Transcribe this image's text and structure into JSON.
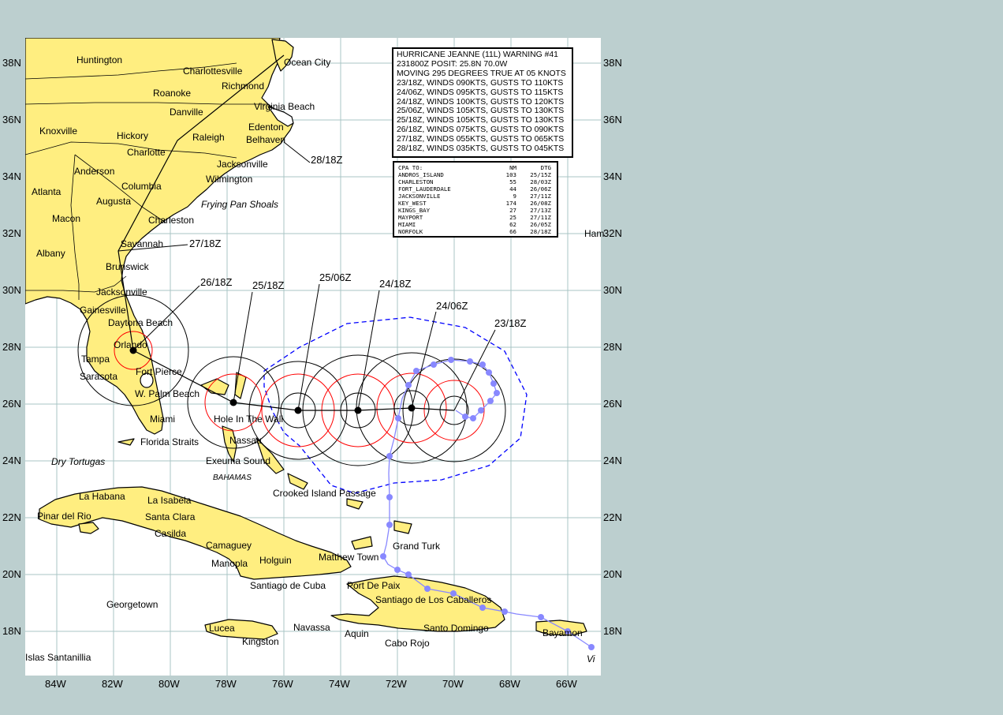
{
  "warning": {
    "lines": [
      "HURRICANE JEANNE (11L) WARNING #41",
      "231800Z POSIT: 25.8N 70.0W",
      "MOVING 295 DEGREES TRUE AT 05 KNOTS",
      "23/18Z, WINDS 090KTS, GUSTS TO 110KTS",
      "24/06Z, WINDS 095KTS, GUSTS TO 115KTS",
      "24/18Z, WINDS 100KTS, GUSTS TO 120KTS",
      "25/06Z, WINDS 105KTS, GUSTS TO 130KTS",
      "25/18Z, WINDS 105KTS, GUSTS TO 130KTS",
      "26/18Z, WINDS 075KTS, GUSTS TO 090KTS",
      "27/18Z, WINDS 055KTS, GUSTS TO 065KTS",
      "28/18Z, WINDS 035KTS, GUSTS TO 045KTS"
    ]
  },
  "cpa": {
    "header": {
      "name": "CPA TO:",
      "nm": "NM",
      "dtg": "DTG"
    },
    "rows": [
      {
        "name": "ANDROS_ISLAND",
        "nm": "103",
        "dtg": "25/15Z"
      },
      {
        "name": "CHARLESTON",
        "nm": "55",
        "dtg": "28/03Z"
      },
      {
        "name": "FORT_LAUDERDALE",
        "nm": "44",
        "dtg": "26/06Z"
      },
      {
        "name": "JACKSONVILLE",
        "nm": "9",
        "dtg": "27/11Z"
      },
      {
        "name": "KEY_WEST",
        "nm": "174",
        "dtg": "26/08Z"
      },
      {
        "name": "KINGS_BAY",
        "nm": "27",
        "dtg": "27/13Z"
      },
      {
        "name": "MAYPORT",
        "nm": "25",
        "dtg": "27/11Z"
      },
      {
        "name": "MIAMI",
        "nm": "62",
        "dtg": "26/05Z"
      },
      {
        "name": "NORFOLK",
        "nm": "66",
        "dtg": "28/18Z"
      }
    ]
  },
  "lat_labels": [
    "38N",
    "36N",
    "34N",
    "32N",
    "30N",
    "28N",
    "26N",
    "24N",
    "22N",
    "20N",
    "18N"
  ],
  "lon_labels": [
    "84W",
    "82W",
    "80W",
    "78W",
    "76W",
    "74W",
    "72W",
    "70W",
    "68W",
    "66W"
  ],
  "forecast_labels": [
    "23/18Z",
    "24/06Z",
    "24/18Z",
    "25/06Z",
    "25/18Z",
    "26/18Z",
    "27/18Z",
    "28/18Z"
  ],
  "places": [
    {
      "name": "Huntington"
    },
    {
      "name": "Charlottesville"
    },
    {
      "name": "Ocean City"
    },
    {
      "name": "Richmond"
    },
    {
      "name": "Roanoke"
    },
    {
      "name": "Virginia Beach"
    },
    {
      "name": "Danville"
    },
    {
      "name": "Edenton"
    },
    {
      "name": "Knoxville"
    },
    {
      "name": "Hickory"
    },
    {
      "name": "Raleigh"
    },
    {
      "name": "Belhaven"
    },
    {
      "name": "Charlotte"
    },
    {
      "name": "Jacksonville"
    },
    {
      "name": "Anderson"
    },
    {
      "name": "Wilmington"
    },
    {
      "name": "Atlanta"
    },
    {
      "name": "Columbia"
    },
    {
      "name": "Augusta"
    },
    {
      "name": "Frying Pan Shoals"
    },
    {
      "name": "Macon"
    },
    {
      "name": "Charleston"
    },
    {
      "name": "Albany"
    },
    {
      "name": "Savannah"
    },
    {
      "name": "Brunswick"
    },
    {
      "name": "Jacksonville"
    },
    {
      "name": "Gainesville"
    },
    {
      "name": "Daytona Beach"
    },
    {
      "name": "Orlando"
    },
    {
      "name": "Tampa"
    },
    {
      "name": "Fort Pierce"
    },
    {
      "name": "Sarasota"
    },
    {
      "name": "W. Palm Beach"
    },
    {
      "name": "Hole In The Wall"
    },
    {
      "name": "Miami"
    },
    {
      "name": "Nassau"
    },
    {
      "name": "Florida Straits"
    },
    {
      "name": "Exeuma Sound"
    },
    {
      "name": "Dry Tortugas"
    },
    {
      "name": "BAHAMAS"
    },
    {
      "name": "Crooked Island Passage"
    },
    {
      "name": "La Habana"
    },
    {
      "name": "La Isabela"
    },
    {
      "name": "Pinar del Rio"
    },
    {
      "name": "Santa Clara"
    },
    {
      "name": "Casilda"
    },
    {
      "name": "Grand Turk"
    },
    {
      "name": "Camaguey"
    },
    {
      "name": "Manopla"
    },
    {
      "name": "Holguin"
    },
    {
      "name": "Matthew Town"
    },
    {
      "name": "Santiago de Cuba"
    },
    {
      "name": "Port De Paix"
    },
    {
      "name": "Santiago de Los Caballeros"
    },
    {
      "name": "Georgetown"
    },
    {
      "name": "Lucea"
    },
    {
      "name": "Navassa"
    },
    {
      "name": "Aquin"
    },
    {
      "name": "Santo Domingo"
    },
    {
      "name": "Bayamon"
    },
    {
      "name": "Kingston"
    },
    {
      "name": "Cabo Rojo"
    },
    {
      "name": "Islas Santanillia"
    },
    {
      "name": "Vi"
    },
    {
      "name": "Ham"
    }
  ],
  "colors": {
    "background": "#bccfcf",
    "ocean": "#ffffff",
    "land": "#ffee80",
    "grid": "#a8c4c4",
    "past_track": "#8888ff",
    "danger_line": "#0000ff",
    "wind34": "#000000",
    "wind50": "#ff0000"
  }
}
